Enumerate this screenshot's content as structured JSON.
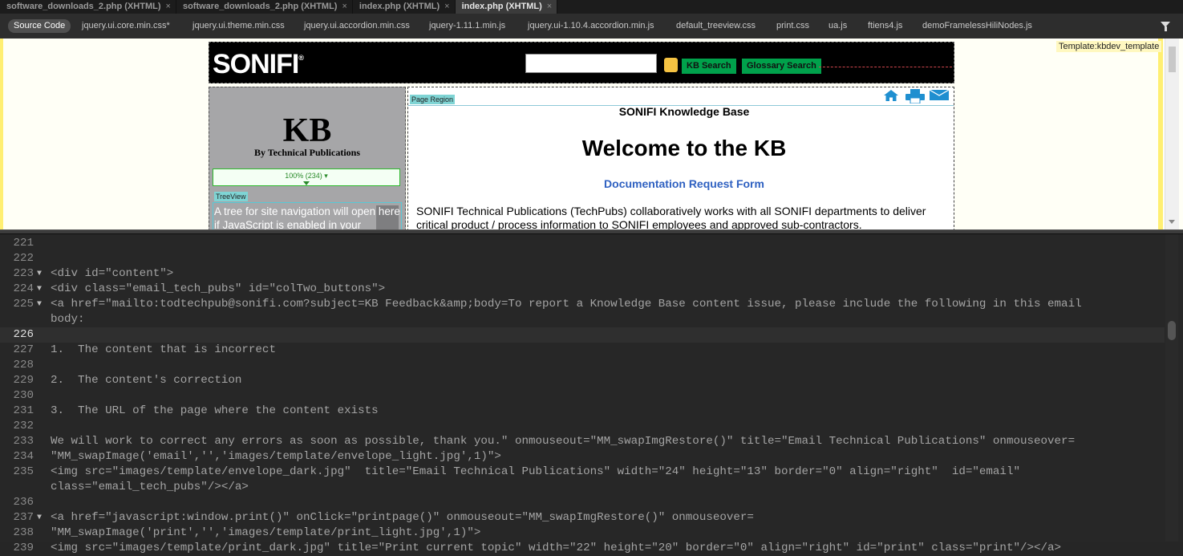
{
  "document_tabs": [
    {
      "label": "software_downloads_2.php (XHTML)",
      "close": "×",
      "active": false
    },
    {
      "label": "software_downloads_2.php (XHTML)",
      "close": "×",
      "active": false
    },
    {
      "label": "index.php (XHTML)",
      "close": "×",
      "active": false
    },
    {
      "label": "index.php (XHTML)",
      "close": "×",
      "active": true
    }
  ],
  "related_files": [
    "Source Code",
    "jquery.ui.core.min.css*",
    "jquery.ui.theme.min.css",
    "jquery.ui.accordion.min.css",
    "jquery-1.11.1.min.js",
    "jquery.ui-1.10.4.accordion.min.js",
    "default_treeview.css",
    "print.css",
    "ua.js",
    "ftiens4.js",
    "demoFramelessHiliNodes.js"
  ],
  "live_view": {
    "template_label": "Template:kbdev_template",
    "header": {
      "logo": "SONIFI",
      "logo_mark": "®",
      "search_value": "",
      "kb_search": "KB Search",
      "glossary_search": "Glossary Search"
    },
    "sidebar": {
      "title": "KB",
      "subtitle": "By Technical Publications",
      "ruler_label": "100% (234) ▾",
      "treeview_tag": "TreeView",
      "treeview_text": "A tree for site navigation will open here if JavaScript is enabled in your"
    },
    "content": {
      "region_tag": "Page Region",
      "kb_title": "SONIFI Knowledge Base",
      "welcome": "Welcome to the KB",
      "doc_request_link": "Documentation Request Form",
      "body": "SONIFI Technical Publications (TechPubs) collaboratively works with all SONIFI departments to deliver critical product / process information to SONIFI employees and approved sub-contractors."
    }
  },
  "code_lines": [
    {
      "num": "221",
      "fold": false,
      "text": ""
    },
    {
      "num": "222",
      "fold": false,
      "text": ""
    },
    {
      "num": "223",
      "fold": true,
      "text": "<div id=\"content\">"
    },
    {
      "num": "224",
      "fold": true,
      "text": "<div class=\"email_tech_pubs\" id=\"colTwo_buttons\">"
    },
    {
      "num": "225",
      "fold": true,
      "text": "<a href=\"mailto:todtechpub@sonifi.com?subject=KB Feedback&amp;body=To report a Knowledge Base content issue, please include the following in this email"
    },
    {
      "num": "",
      "fold": false,
      "text": "body:"
    },
    {
      "num": "226",
      "fold": false,
      "text": "",
      "current": true
    },
    {
      "num": "227",
      "fold": false,
      "text": "1.  The content that is incorrect"
    },
    {
      "num": "228",
      "fold": false,
      "text": ""
    },
    {
      "num": "229",
      "fold": false,
      "text": "2.  The content's correction"
    },
    {
      "num": "230",
      "fold": false,
      "text": ""
    },
    {
      "num": "231",
      "fold": false,
      "text": "3.  The URL of the page where the content exists"
    },
    {
      "num": "232",
      "fold": false,
      "text": ""
    },
    {
      "num": "233",
      "fold": false,
      "text": "We will work to correct any errors as soon as possible, thank you.\" onmouseout=\"MM_swapImgRestore()\" title=\"Email Technical Publications\" onmouseover="
    },
    {
      "num": "234",
      "fold": false,
      "text": "\"MM_swapImage('email','','images/template/envelope_light.jpg',1)\">"
    },
    {
      "num": "235",
      "fold": false,
      "text": "<img src=\"images/template/envelope_dark.jpg\"  title=\"Email Technical Publications\" width=\"24\" height=\"13\" border=\"0\" align=\"right\"  id=\"email\""
    },
    {
      "num": "",
      "fold": false,
      "text": "class=\"email_tech_pubs\"/></a>"
    },
    {
      "num": "236",
      "fold": false,
      "text": ""
    },
    {
      "num": "237",
      "fold": true,
      "text": "<a href=\"javascript:window.print()\" onClick=\"printpage()\" onmouseout=\"MM_swapImgRestore()\" onmouseover="
    },
    {
      "num": "238",
      "fold": false,
      "text": "\"MM_swapImage('print','','images/template/print_light.jpg',1)\">"
    },
    {
      "num": "239",
      "fold": false,
      "text": "<img src=\"images/template/print_dark.jpg\" title=\"Print current topic\" width=\"22\" height=\"20\" border=\"0\" align=\"right\" id=\"print\" class=\"print\"/></a>"
    }
  ],
  "colors": {
    "accent_green": "#00a14b",
    "link_blue": "#2f61c1",
    "code_text": "#a4a4a4",
    "editor_bg": "#272727"
  },
  "icons": {
    "filter": "filter-icon",
    "fold": "fold-arrow-icon",
    "lock": "lock-icon",
    "home": "home-icon",
    "print": "print-icon",
    "email": "envelope-icon"
  }
}
